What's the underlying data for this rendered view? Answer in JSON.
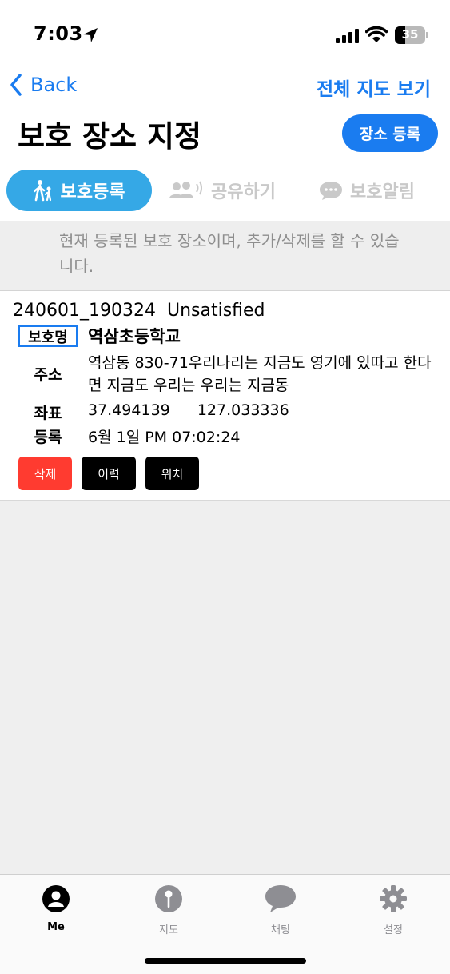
{
  "status": {
    "time": "7:03",
    "battery": "35",
    "battery_level": 0.35
  },
  "nav": {
    "back": "Back",
    "full_map": "전체 지도 보기"
  },
  "header": {
    "title": "보호 장소 지정",
    "register_button": "장소 등록"
  },
  "tabs": [
    {
      "label": "보호등록",
      "icon": "walking-person-icon",
      "active": true
    },
    {
      "label": "공유하기",
      "icon": "people-sound-icon",
      "active": false
    },
    {
      "label": "보호알림",
      "icon": "chat-bubble-icon",
      "active": false
    }
  ],
  "info": "현재 등록된 보호 장소이며, 추가/삭제를 할 수 있습니다.",
  "record": {
    "id": "240601_190324",
    "status": "Unsatisfied",
    "name_label": "보호명",
    "name": "역삼초등학교",
    "address_label": "주소",
    "address": "역삼동 830-71우리나리는 지금도 영기에 있따고 한다면 지금도 우리는 우리는 지금동",
    "coords_label": "좌표",
    "lat": "37.494139",
    "lng": "127.033336",
    "registered_label": "등록",
    "registered": "6월 1일 PM 07:02:24",
    "buttons": {
      "delete": "삭제",
      "history": "이력",
      "location": "위치"
    }
  },
  "tabbar": [
    {
      "label": "Me",
      "icon": "person-icon",
      "active": true
    },
    {
      "label": "지도",
      "icon": "map-pin-icon",
      "active": false
    },
    {
      "label": "채팅",
      "icon": "chat-icon",
      "active": false
    },
    {
      "label": "설정",
      "icon": "gear-icon",
      "active": false
    }
  ],
  "colors": {
    "accent": "#1a7cf0",
    "tab_active": "#35a8e6",
    "danger": "#ff3b30"
  }
}
